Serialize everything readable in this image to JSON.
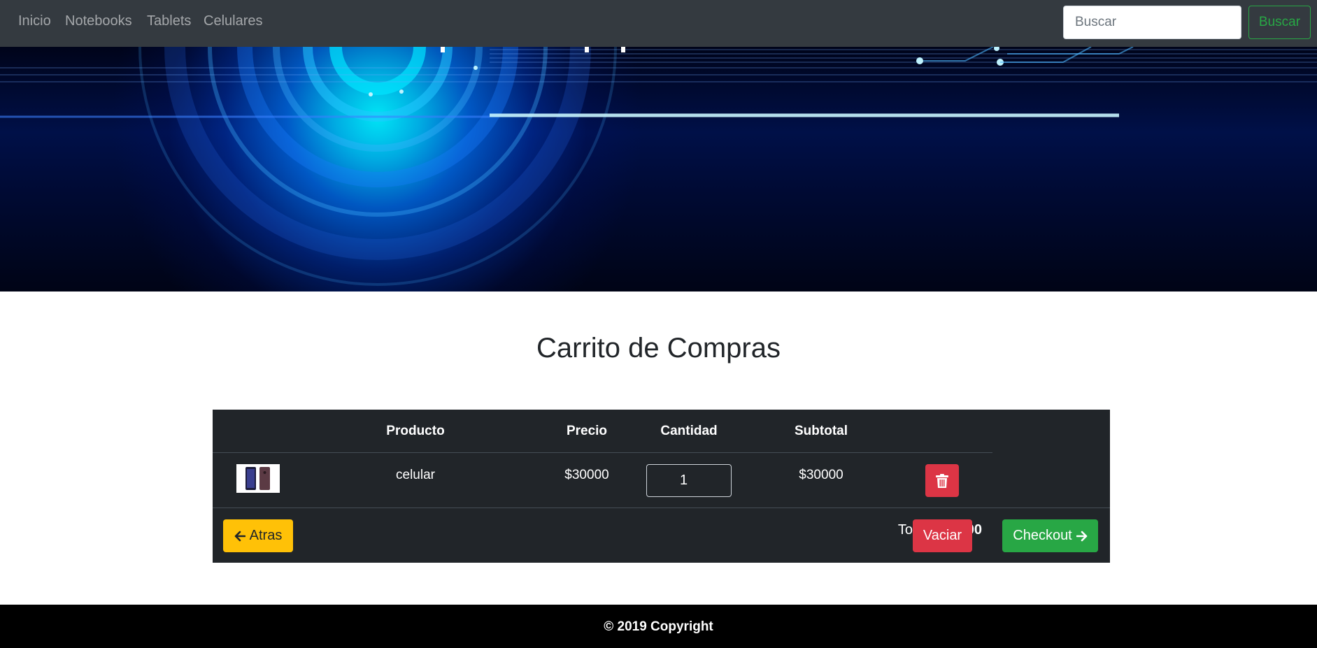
{
  "nav": {
    "links": [
      {
        "label": "Inicio"
      },
      {
        "label": "Notebooks"
      },
      {
        "label": "Tablets"
      },
      {
        "label": "Celulares"
      }
    ],
    "search_placeholder": "Buscar",
    "search_button": "Buscar"
  },
  "page_title": "Carrito de Compras",
  "cart": {
    "headers": {
      "image": "",
      "product": "Producto",
      "price": "Precio",
      "quantity": "Cantidad",
      "subtotal": "Subtotal"
    },
    "items": [
      {
        "image_icon": "phone-thumbnail-icon",
        "product": "celular",
        "price": "$30000",
        "quantity": "1",
        "subtotal": "$30000",
        "delete_icon": "trash-icon"
      }
    ],
    "back_button": "Atras",
    "total_label": "Total:",
    "total_value": "$30000",
    "empty_button": "Vaciar",
    "checkout_button": "Checkout"
  },
  "footer": {
    "copyright": "© 2019 Copyright"
  },
  "colors": {
    "navbar": "#343a40",
    "table_bg": "#212529",
    "warning": "#ffc107",
    "danger": "#dc3545",
    "success": "#28a745",
    "footer": "#000000"
  }
}
